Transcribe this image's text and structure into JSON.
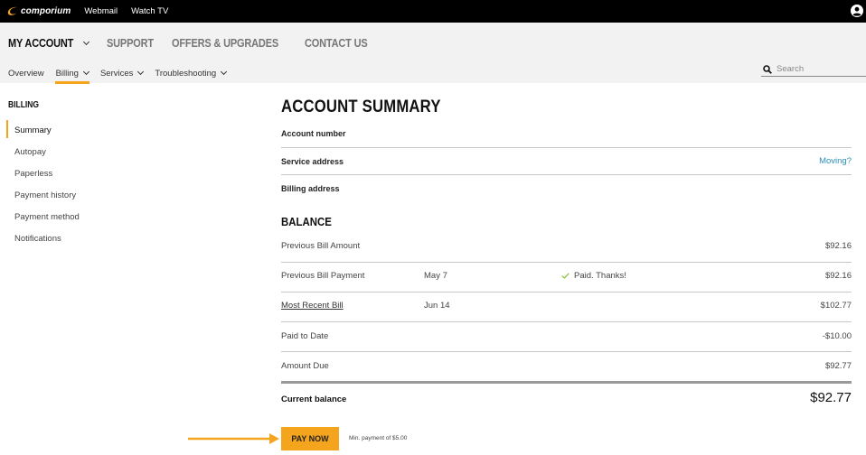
{
  "topbar": {
    "brand": "comporium",
    "links": [
      "Webmail",
      "Watch TV"
    ]
  },
  "primary_nav": {
    "items": [
      "MY ACCOUNT",
      "SUPPORT",
      "OFFERS & UPGRADES",
      "CONTACT US"
    ]
  },
  "secondary_nav": {
    "items": [
      "Overview",
      "Billing",
      "Services",
      "Troubleshooting"
    ]
  },
  "search": {
    "placeholder": "Search"
  },
  "sidebar": {
    "heading": "BILLING",
    "items": [
      "Summary",
      "Autopay",
      "Paperless",
      "Payment history",
      "Payment method",
      "Notifications"
    ]
  },
  "summary": {
    "title": "ACCOUNT SUMMARY",
    "account_number_label": "Account number",
    "service_address_label": "Service address",
    "moving_link": "Moving?",
    "billing_address_label": "Billing address"
  },
  "balance": {
    "heading": "BALANCE",
    "rows": [
      {
        "label": "Previous Bill Amount",
        "date": "",
        "status": "",
        "amount": "$92.16"
      },
      {
        "label": "Previous Bill Payment",
        "date": "May 7",
        "status": "Paid. Thanks!",
        "amount": "$92.16"
      },
      {
        "label": "Most Recent Bill",
        "date": "Jun 14",
        "status": "",
        "amount": "$102.77"
      },
      {
        "label": "Paid to Date",
        "date": "",
        "status": "",
        "amount": "-$10.00"
      },
      {
        "label": "Amount Due",
        "date": "",
        "status": "",
        "amount": "$92.77"
      }
    ],
    "current_label": "Current balance",
    "current_amount": "$92.77"
  },
  "pay": {
    "button_label": "PAY NOW",
    "min_payment": "Min. payment of $5.00"
  },
  "colors": {
    "accent": "#f5a41d",
    "link": "#2a8fb8",
    "check": "#8cc63f"
  }
}
